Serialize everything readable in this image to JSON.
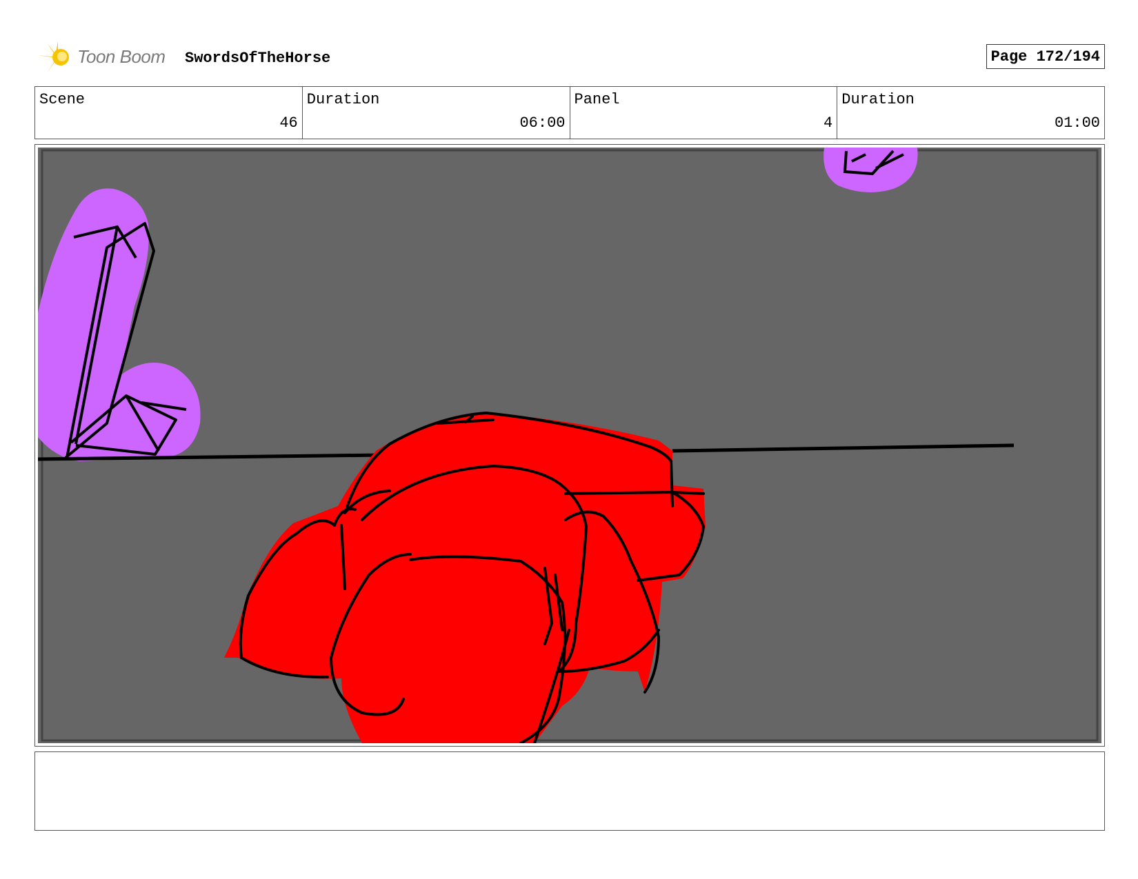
{
  "header": {
    "logo_text": "Toon Boom",
    "project_title": "SwordsOfTheHorse",
    "page_label": "Page 172/194"
  },
  "info": {
    "scene_label": "Scene",
    "scene_value": "46",
    "scene_duration_label": "Duration",
    "scene_duration_value": "06:00",
    "panel_label": "Panel",
    "panel_value": "4",
    "panel_duration_label": "Duration",
    "panel_duration_value": "01:00"
  },
  "panel": {
    "background_color": "#666666",
    "sword_color": "#cc66ff",
    "creature_color": "#ff0000",
    "line_color": "#000000"
  },
  "notes": {
    "text": ""
  }
}
